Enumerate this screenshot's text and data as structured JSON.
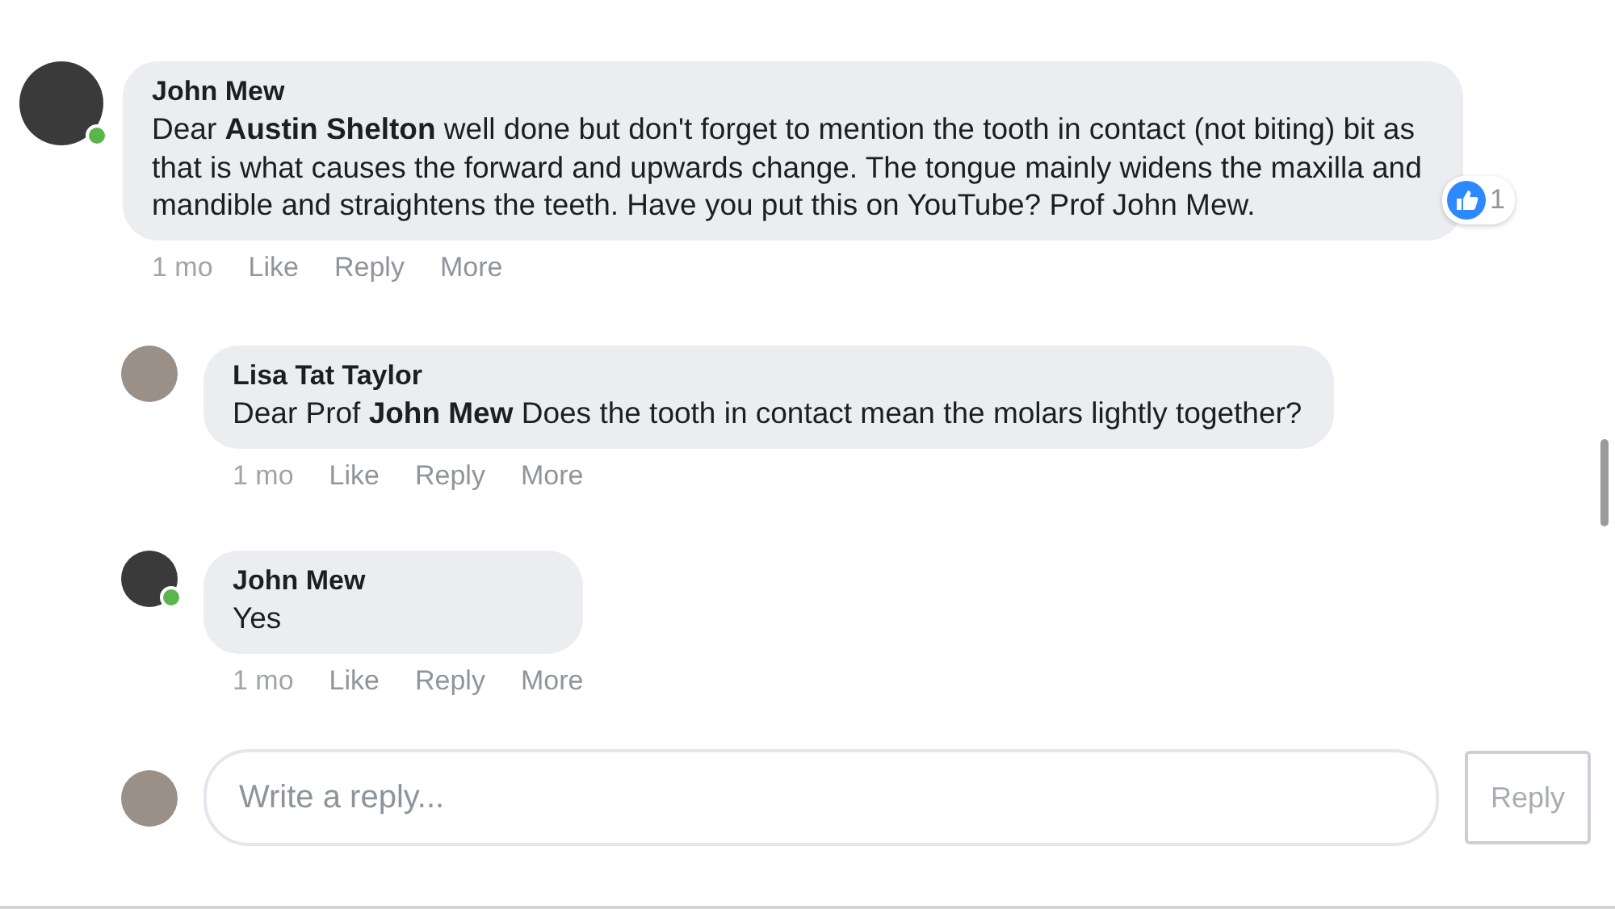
{
  "comments": [
    {
      "author": "John Mew",
      "online": true,
      "text": "Dear **Austin Shelton** well done but don't forget to mention the tooth in contact (not biting) bit as that is what causes the forward and upwards change. The tongue mainly widens the maxilla and mandible and straightens the teeth. Have you put this on YouTube? Prof John Mew.",
      "reaction_count": "1",
      "time": "1 mo",
      "actions": [
        "Like",
        "Reply",
        "More"
      ],
      "replies": [
        {
          "author": "Lisa Tat Taylor",
          "online": false,
          "text": "Dear Prof **John Mew** Does the tooth in contact mean the molars lightly together?",
          "time": "1 mo",
          "actions": [
            "Like",
            "Reply",
            "More"
          ]
        },
        {
          "author": "John Mew",
          "online": true,
          "text": "Yes",
          "time": "1 mo",
          "actions": [
            "Like",
            "Reply",
            "More"
          ]
        }
      ]
    }
  ],
  "reply_box": {
    "placeholder": "Write a reply...",
    "button": "Reply"
  }
}
